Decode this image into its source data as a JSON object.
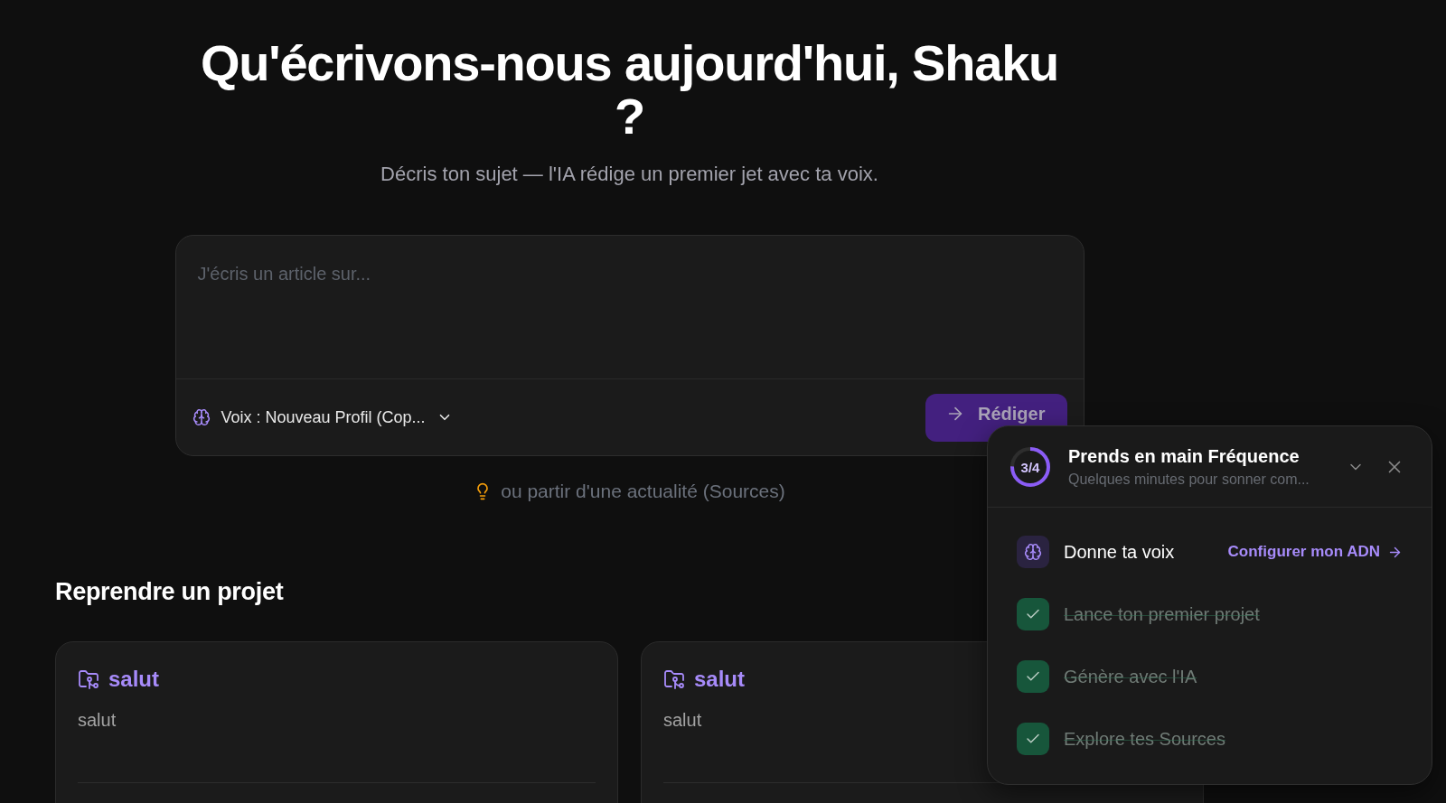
{
  "heading": {
    "title": "Qu'écrivons-nous aujourd'hui, Shaku ?",
    "subtitle": "Décris ton sujet — l'IA rédige un premier jet avec ta voix."
  },
  "composer": {
    "placeholder": "J'écris un article sur...",
    "voice_selector": "Voix : Nouveau Profil (Cop...",
    "submit": {
      "label": "Rédiger",
      "disabled": true
    }
  },
  "sources_link": "ou partir d'une actualité (Sources)",
  "projects": {
    "title": "Reprendre un projet",
    "cards": [
      {
        "name": "salut",
        "description": "salut"
      },
      {
        "name": "salut",
        "description": "salut"
      }
    ]
  },
  "onboarding": {
    "progress": {
      "label": "3/4",
      "level": 0.75
    },
    "title": "Prends en main Fréquence",
    "subtitle": "Quelques minutes pour sonner com...",
    "steps": [
      {
        "label": "Donne ta voix",
        "done": false,
        "action": "Configurer mon ADN"
      },
      {
        "label": "Lance ton premier projet",
        "done": true
      },
      {
        "label": "Génère avec l'IA",
        "done": true
      },
      {
        "label": "Explore tes Sources",
        "done": true
      }
    ]
  }
}
